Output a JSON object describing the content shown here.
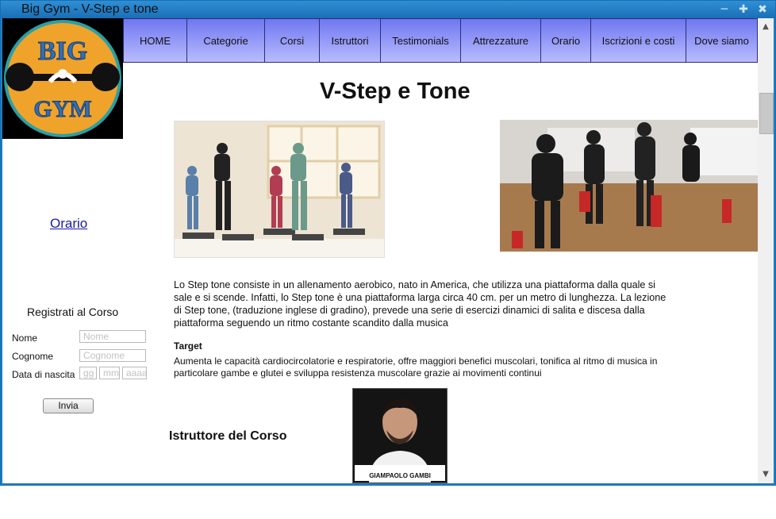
{
  "window": {
    "title": "Big Gym - V-Step e tone",
    "controls": [
      "minimize",
      "maximize",
      "close"
    ]
  },
  "logo": {
    "alt": "BIG GYM logo",
    "text_top": "BIG",
    "text_bottom": "GYM"
  },
  "nav": {
    "items": [
      "HOME",
      "Categorie",
      "Corsi",
      "Istruttori",
      "Testimonials",
      "Attrezzature",
      "Orario",
      "Iscrizioni e costi",
      "Dove siamo"
    ]
  },
  "main": {
    "title": "V-Step e Tone",
    "description": "Lo Step tone consiste in un allenamento aerobico, nato in America, che utilizza una piattaforma dalla quale si sale e si scende. Infatti, lo Step tone è una piattaforma larga circa 40 cm. per un metro di lunghezza. La lezione di Step tone, (traduzione inglese di gradino), prevede una serie di esercizi dinamici di salita e discesa dalla piattaforma seguendo un ritmo costante scandito dalla musica",
    "target_heading": "Target",
    "target_text": "Aumenta le capacità cardiocircolatorie e respiratorie, offre maggiori benefici muscolari, tonifica al ritmo di musica in particolare gambe e glutei e sviluppa resistenza muscolare grazie ai movimenti continui",
    "instructor_heading": "Istruttore del Corso",
    "instructor_caption": "GIAMPAOLO GAMBI"
  },
  "sidebar": {
    "schedule_link": "Orario",
    "form": {
      "title": "Registrati al Corso",
      "name_label": "Nome",
      "name_placeholder": "Nome",
      "surname_label": "Cognome",
      "surname_placeholder": "Cognome",
      "birth_label": "Data di nascita",
      "day_placeholder": "gg",
      "month_placeholder": "mm",
      "year_placeholder": "aaaa",
      "submit_label": "Invia"
    }
  },
  "colors": {
    "nav_top": "#6f77ef",
    "nav_bottom": "#b9bcff",
    "window_frame": "#1e7dc4",
    "logo_orange": "#f0a32b",
    "logo_blue": "#2f6fb5",
    "link": "#1a1aa8"
  }
}
